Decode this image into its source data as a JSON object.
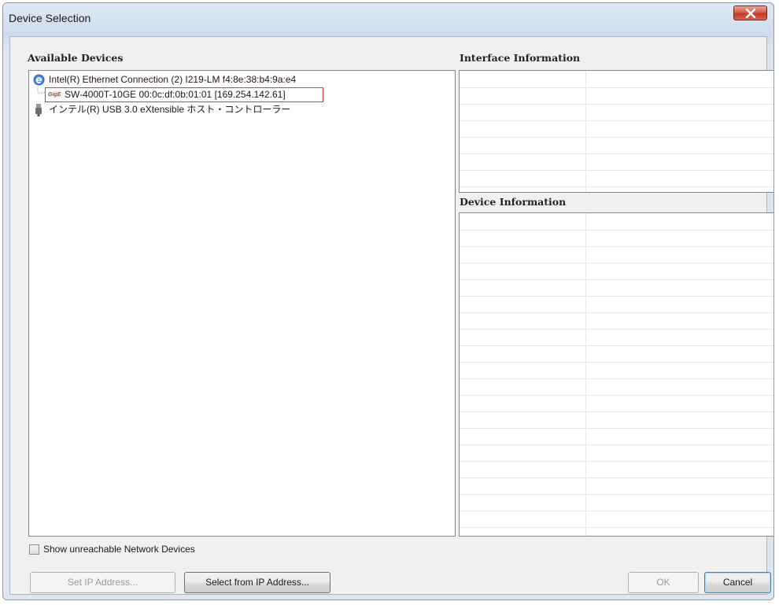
{
  "window": {
    "title": "Device Selection"
  },
  "available_devices": {
    "label": "Available Devices",
    "items": [
      {
        "text": "Intel(R) Ethernet Connection (2) I219-LM f4:8e:38:b4:9a:e4",
        "icon": "ethernet-adapter-icon"
      },
      {
        "text": "SW-4000T-10GE 00:0c:df:0b:01:01 [169.254.142.61]",
        "icon": "gige-camera-icon",
        "icon_text": "GigE"
      },
      {
        "text": "インテル(R) USB 3.0 eXtensible ホスト・コントローラー",
        "icon": "usb-controller-icon"
      }
    ]
  },
  "interface_information": {
    "label": "Interface Information"
  },
  "device_information": {
    "label": "Device Information"
  },
  "options": {
    "show_unreachable_label": "Show unreachable Network Devices",
    "show_unreachable_checked": false
  },
  "buttons": {
    "set_ip": "Set IP Address...",
    "select_from_ip": "Select from IP Address...",
    "ok": "OK",
    "cancel": "Cancel"
  },
  "colors": {
    "selection_outline": "#e53935",
    "ethernet_icon": "#2f6fcf",
    "close_button": "#c9432e"
  }
}
